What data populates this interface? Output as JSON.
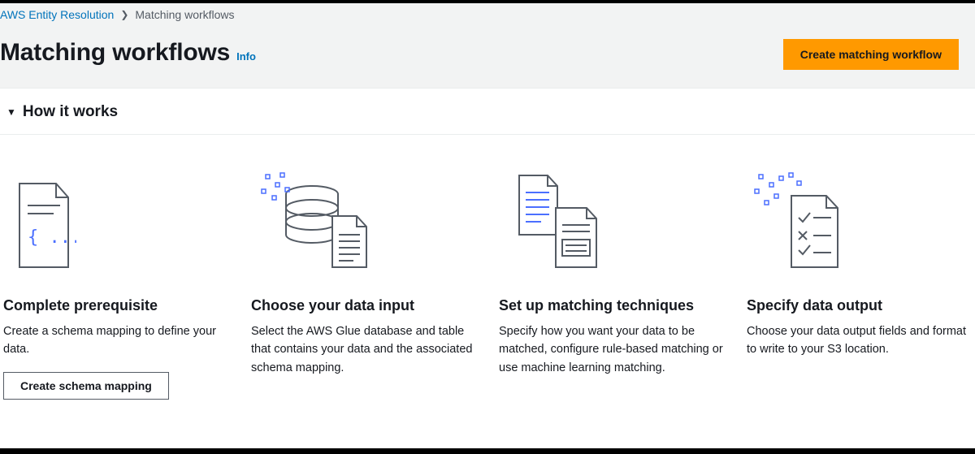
{
  "breadcrumb": {
    "root": "AWS Entity Resolution",
    "current": "Matching workflows"
  },
  "header": {
    "title": "Matching workflows",
    "info": "Info",
    "create_btn": "Create matching workflow"
  },
  "howitworks": {
    "title": "How it works",
    "cards": [
      {
        "title": "Complete prerequisite",
        "desc": "Create a schema mapping to define your data.",
        "action": "Create schema mapping"
      },
      {
        "title": "Choose your data input",
        "desc": "Select the AWS Glue database and table that contains your data and the associated schema mapping."
      },
      {
        "title": "Set up matching techniques",
        "desc": "Specify how you want your data to be matched, configure rule-based matching or use machine learning matching."
      },
      {
        "title": "Specify data output",
        "desc": "Choose your data output fields and format to write to your S3 location."
      }
    ]
  }
}
